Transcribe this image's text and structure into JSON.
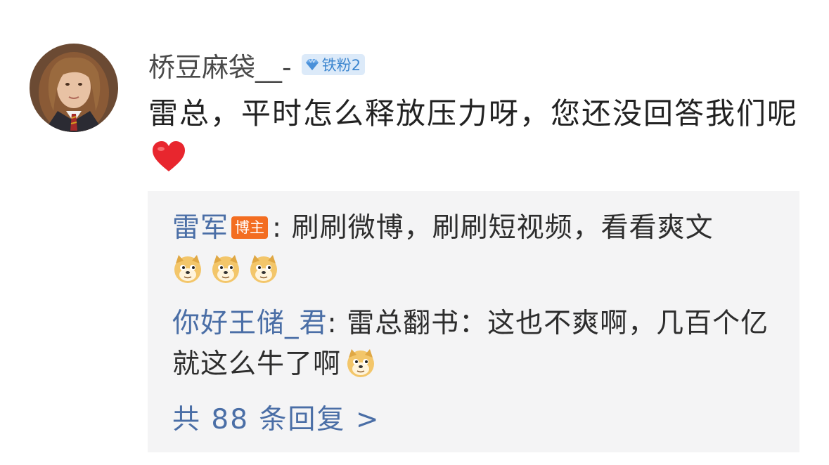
{
  "comment": {
    "username": "桥豆麻袋__-",
    "fan_badge": "铁粉2",
    "text": "雷总，平时怎么释放压力呀，您还没回答我们呢",
    "icons": [
      "avatar",
      "diamond-icon",
      "heart-icon"
    ]
  },
  "replies": [
    {
      "author": "雷军",
      "badge": "博主",
      "separator": ":",
      "text": "刷刷微博，刷刷短视频，看看爽文",
      "icons": [
        "doge-emoji",
        "doge-emoji",
        "doge-emoji"
      ]
    },
    {
      "author": "你好王储_君",
      "separator": ":",
      "text": "雷总翻书：这也不爽啊，几百个亿就这么牛了啊",
      "icons": [
        "doge-emoji"
      ]
    }
  ],
  "more_replies": "共 88 条回复 >",
  "colors": {
    "link_blue": "#4a6ea6",
    "badge_orange": "#f36d21",
    "fan_badge_bg": "#dceaf9",
    "fan_badge_text": "#3d86cf",
    "reply_bg": "#f4f4f5",
    "heart_red": "#e8262e"
  }
}
